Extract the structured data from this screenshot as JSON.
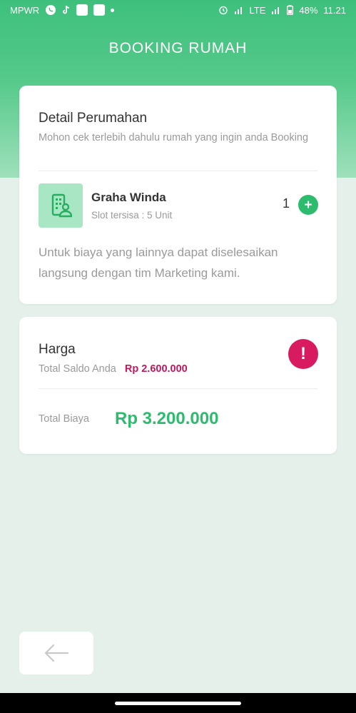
{
  "status_bar": {
    "carrier": "MPWR",
    "network": "LTE",
    "battery": "48%",
    "time": "11.21",
    "icons": [
      "whatsapp-icon",
      "tiktok-icon",
      "app-square-icon",
      "app-square-icon",
      "dot-icon",
      "alarm-icon",
      "signal-icon",
      "battery-icon"
    ]
  },
  "header": {
    "title": "BOOKING RUMAH"
  },
  "detail_card": {
    "title": "Detail Perumahan",
    "subtitle": "Mohon cek terlebih dahulu rumah yang ingin anda Booking",
    "house": {
      "icon": "building-person-icon",
      "name": "Graha Winda",
      "slot": "Slot tersisa : 5 Unit",
      "quantity": "1",
      "add_label": "+"
    },
    "note": "Untuk biaya yang lainnya dapat diselesaikan langsung dengan tim Marketing kami."
  },
  "harga_card": {
    "title": "Harga",
    "saldo_label": "Total Saldo Anda",
    "saldo_amount": "Rp 2.600.000",
    "alert_label": "!",
    "biaya_label": "Total Biaya",
    "biaya_amount": "Rp 3.200.000"
  },
  "footer": {
    "back_icon": "arrow-left-icon"
  },
  "colors": {
    "primary_green": "#2dbb6e",
    "header_green": "#3ec07c",
    "accent_pink": "#d81b60",
    "background": "#e6f0ea"
  }
}
